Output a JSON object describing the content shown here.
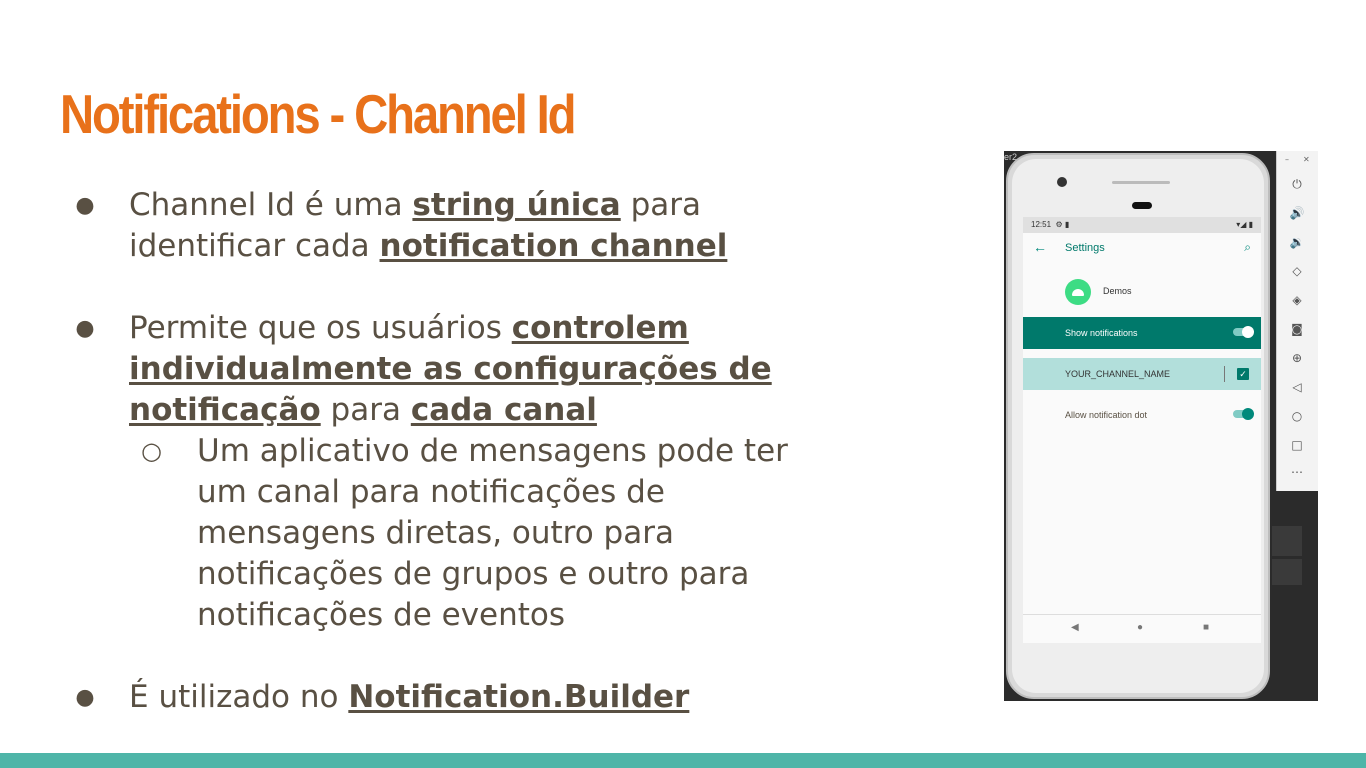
{
  "slide": {
    "title": "Notifications - Channel Id",
    "bullet1": {
      "pre": "Channel Id é uma ",
      "em1": "string única",
      "mid": " para identificar cada ",
      "em2": "notification channel"
    },
    "bullet2": {
      "pre": "Permite que os usuários ",
      "em1": "controlem individualmente as configurações de notificação",
      "mid": " para ",
      "em2": "cada canal",
      "sub": "Um aplicativo de mensagens pode ter um canal para notificações de mensagens diretas, outro para notificações de grupos e outro para notificações de eventos"
    },
    "bullet3": {
      "pre": "É utilizado no ",
      "em1": "Notification.Builder"
    },
    "bullet_glyph": "●",
    "sub_bullet_glyph": "○"
  },
  "emulator": {
    "window_title": "er2",
    "status_time": "12:51",
    "status_icons": "▾◢ ▮",
    "screen_title": "Settings",
    "app_name": "Demos",
    "rows": {
      "show_notifications": "Show notifications",
      "channel_name": "YOUR_CHANNEL_NAME",
      "allow_dot": "Allow notification dot"
    },
    "toolbar_icons": [
      "power-icon",
      "volume-up-icon",
      "volume-down-icon",
      "rotate-left-icon",
      "rotate-right-icon",
      "camera-icon",
      "zoom-icon",
      "back-icon",
      "home-icon",
      "overview-icon",
      "more-icon"
    ]
  },
  "colors": {
    "title": "#e8711a",
    "body_text": "#595043",
    "footer_bar": "#4eb5a8",
    "android_teal": "#00796b"
  }
}
